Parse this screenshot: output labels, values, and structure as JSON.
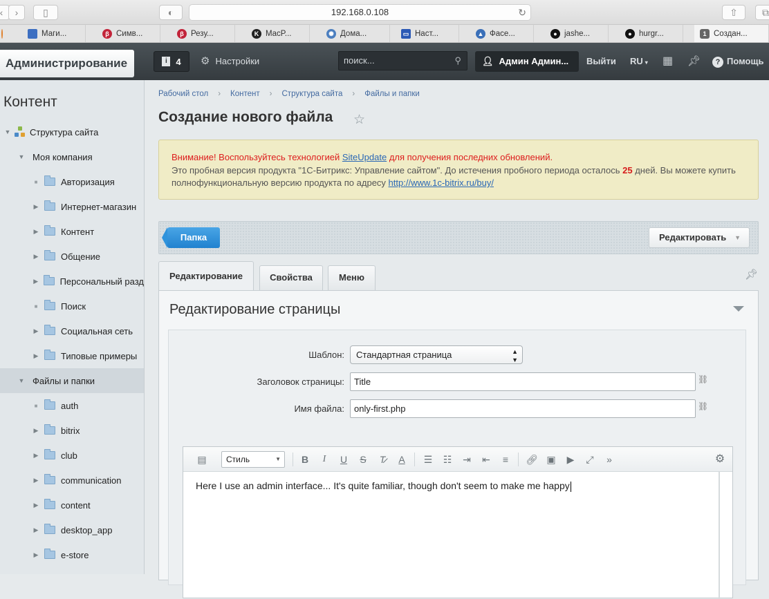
{
  "browser": {
    "url": "192.168.0.108",
    "bookmarks": [
      {
        "label": "Маги...",
        "color": "#3d6fc1"
      },
      {
        "label": "Симв...",
        "color": "#c2243a"
      },
      {
        "label": "Резу...",
        "color": "#c2243a"
      },
      {
        "label": "MacP...",
        "color": "#222222"
      },
      {
        "label": "Дома...",
        "color": "#4c7fbf"
      },
      {
        "label": "Наст...",
        "color": "#2b59b5"
      },
      {
        "label": "Фасе...",
        "color": "#3a6fb8"
      },
      {
        "label": "jashe...",
        "color": "#111111"
      },
      {
        "label": "hurgr...",
        "color": "#111111"
      },
      {
        "label": "Создан...",
        "color": "#555555",
        "badge": "1"
      }
    ]
  },
  "admin": {
    "title": "Администрирование",
    "notifications": "4",
    "settings": "Настройки",
    "search_placeholder": "поиск...",
    "user": "Админ Админ...",
    "logout": "Выйти",
    "lang": "RU",
    "help": "Помощь"
  },
  "sidebar": {
    "title": "Контент",
    "items": [
      {
        "label": "Структура сайта"
      },
      {
        "label": "Моя компания"
      },
      {
        "label": "Авторизация"
      },
      {
        "label": "Интернет-магазин"
      },
      {
        "label": "Контент"
      },
      {
        "label": "Общение"
      },
      {
        "label": "Персональный разд"
      },
      {
        "label": "Поиск"
      },
      {
        "label": "Социальная сеть"
      },
      {
        "label": "Типовые примеры"
      },
      {
        "label": "Файлы и папки"
      },
      {
        "label": "auth"
      },
      {
        "label": "bitrix"
      },
      {
        "label": "club"
      },
      {
        "label": "communication"
      },
      {
        "label": "content"
      },
      {
        "label": "desktop_app"
      },
      {
        "label": "e-store"
      }
    ]
  },
  "main": {
    "breadcrumbs": [
      "Рабочий стол",
      "Контент",
      "Структура сайта",
      "Файлы и папки"
    ],
    "title": "Создание нового файла",
    "warning": {
      "line1_prefix": "Внимание! Воспользуйтесь технологией ",
      "line1_link": "SiteUpdate",
      "line1_suffix": " для получения последних обновлений.",
      "line2_prefix": "Это пробная версия продукта \"1С-Битрикс: Управление сайтом\". До истечения пробного периода осталось ",
      "days": "25",
      "line2_mid": " дней. Вы можете купить полнофункциональную версию продукта по адресу ",
      "line2_link": "http://www.1c-bitrix.ru/buy/"
    },
    "folder_button": "Папка",
    "edit_button": "Редактировать",
    "tabs": [
      "Редактирование",
      "Свойства",
      "Меню"
    ],
    "section_title": "Редактирование страницы",
    "form": {
      "template_label": "Шаблон:",
      "template_value": "Стандартная страница",
      "page_title_label": "Заголовок страницы:",
      "page_title_value": "Title",
      "filename_label": "Имя файла:",
      "filename_value": "only-first.php"
    },
    "editor": {
      "style_select": "Стиль",
      "content": "Here I use an admin interface... It's quite familiar, though don't seem to make me happy"
    }
  }
}
